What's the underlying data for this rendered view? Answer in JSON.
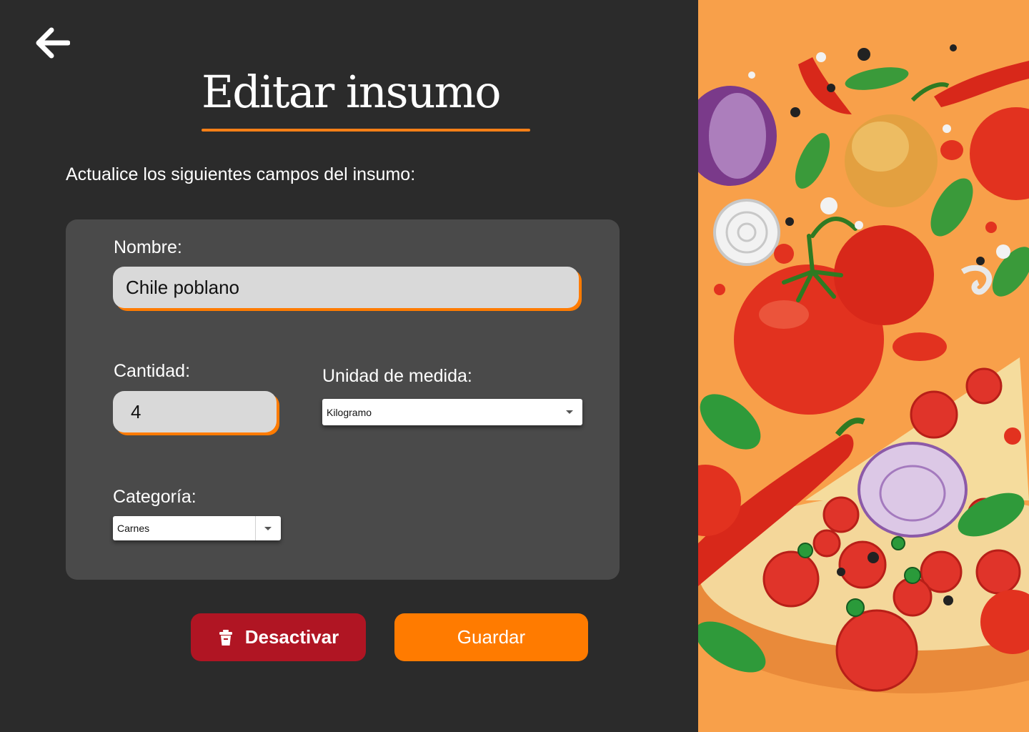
{
  "header": {
    "title": "Editar insumo",
    "subtitle": "Actualice los siguientes campos del insumo:"
  },
  "form": {
    "nombre": {
      "label": "Nombre:",
      "value": "Chile poblano"
    },
    "cantidad": {
      "label": "Cantidad:",
      "value": "4"
    },
    "unidad": {
      "label": "Unidad de medida:",
      "value": "Kilogramo"
    },
    "categoria": {
      "label": "Categoría:",
      "value": "Carnes"
    }
  },
  "actions": {
    "deactivate_label": "Desactivar",
    "save_label": "Guardar"
  },
  "icons": {
    "back": "arrow-left-icon",
    "trash": "trash-icon",
    "dropdown": "caret-down-icon"
  },
  "colors": {
    "background": "#2b2b2b",
    "card": "#4a4a4a",
    "accent": "#ff7b00",
    "danger": "#b01523",
    "input_bg": "#d9d9d9",
    "illustration_bg": "#f8a04a"
  }
}
